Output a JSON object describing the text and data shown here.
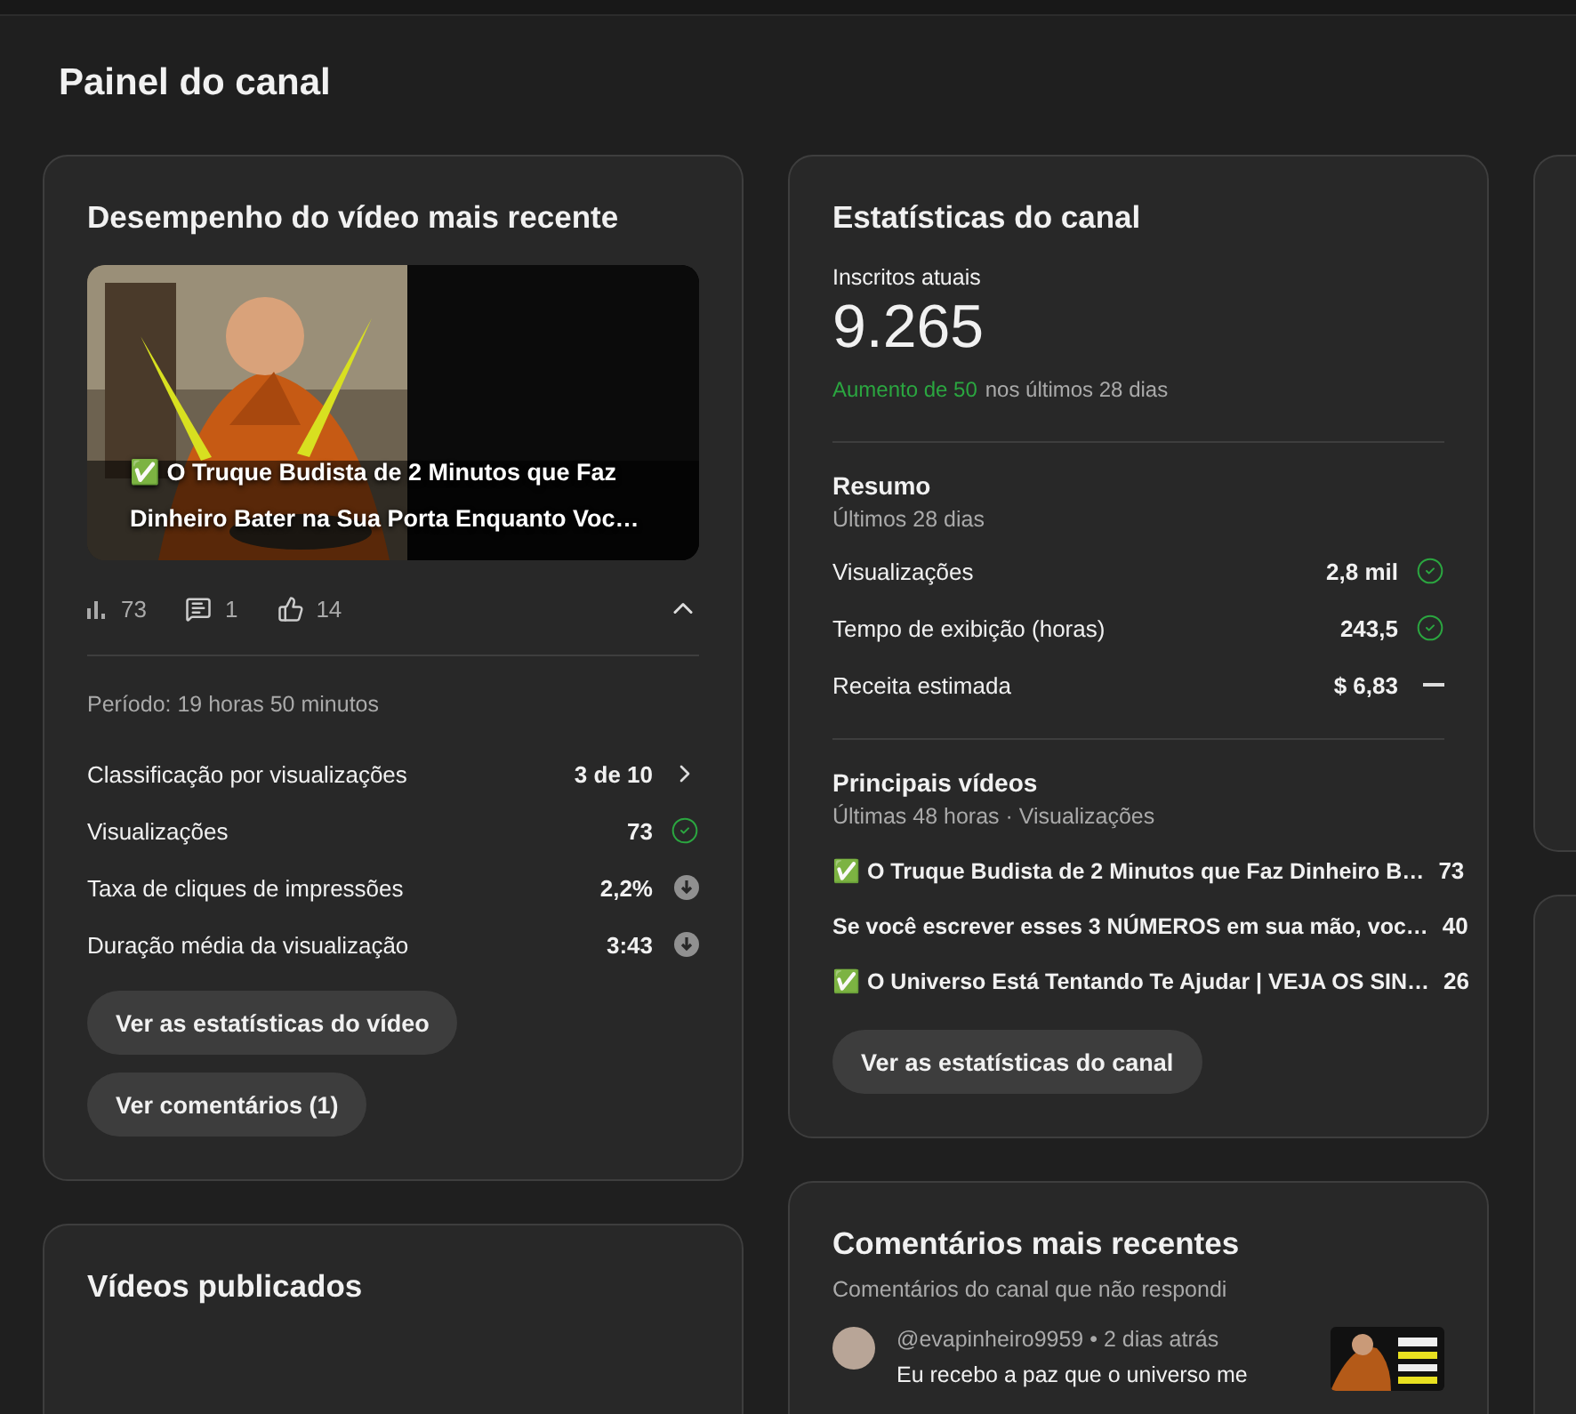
{
  "page_title": "Painel do canal",
  "latest_video": {
    "title": "Desempenho do vídeo mais recente",
    "thumbnail": {
      "kind": "picture"
    },
    "video_title": "✅ O Truque Budista de 2 Minutos que Faz Dinheiro Bater na Sua Porta Enquanto Voc…",
    "stats": [
      {
        "kind": "views",
        "value": "73"
      },
      {
        "kind": "comments",
        "value": "1"
      },
      {
        "kind": "likes",
        "value": "14"
      }
    ],
    "expanded": true,
    "period": "Período: 19 horas 50 minutos",
    "metrics": [
      {
        "label": "Classificação por visualizações",
        "value": "3 de 10",
        "kind": "chevron"
      },
      {
        "label": "Visualizações",
        "value": "73",
        "kind": "check"
      },
      {
        "label": "Taxa de cliques de impressões",
        "value": "2,2%",
        "kind": "down"
      },
      {
        "label": "Duração média da visualização",
        "value": "3:43",
        "kind": "down"
      }
    ],
    "buttons": [
      "Ver as estatísticas do vídeo",
      "Ver comentários (1)"
    ]
  },
  "published": {
    "title": "Vídeos publicados"
  },
  "channel_stats": {
    "title": "Estatísticas do canal",
    "subscribers_label": "Inscritos atuais",
    "subscribers": "9.265",
    "change": "Aumento de 50",
    "change_period": "nos últimos 28 dias",
    "summary_title": "Resumo",
    "summary_period": "Últimos 28 dias",
    "summary": [
      {
        "label": "Visualizações",
        "value": "2,8 mil",
        "kind": "check"
      },
      {
        "label": "Tempo de exibição (horas)",
        "value": "243,5",
        "kind": "check"
      },
      {
        "label": "Receita estimada",
        "value": "$ 6,83",
        "kind": "dash"
      }
    ],
    "top_title": "Principais vídeos",
    "top_period": "Últimas 48 horas · Visualizações",
    "top_videos": [
      {
        "title": "✅ O Truque Budista de 2 Minutos que Faz Dinheiro B…",
        "views": "73"
      },
      {
        "title": "Se você escrever esses 3 NÚMEROS em sua mão, voc…",
        "views": "40"
      },
      {
        "title": "✅ O Universo Está Tentando Te Ajudar | VEJA OS SIN…",
        "views": "26"
      }
    ],
    "button": "Ver as estatísticas do canal"
  },
  "comments": {
    "title": "Comentários mais recentes",
    "subtitle": "Comentários do canal que não respondi",
    "items": [
      {
        "author": "@evapinheiro9959 • 2 dias atrás",
        "text": "Eu recebo a paz que o universo me",
        "thumbnail": {
          "kind": "picture"
        }
      }
    ]
  }
}
